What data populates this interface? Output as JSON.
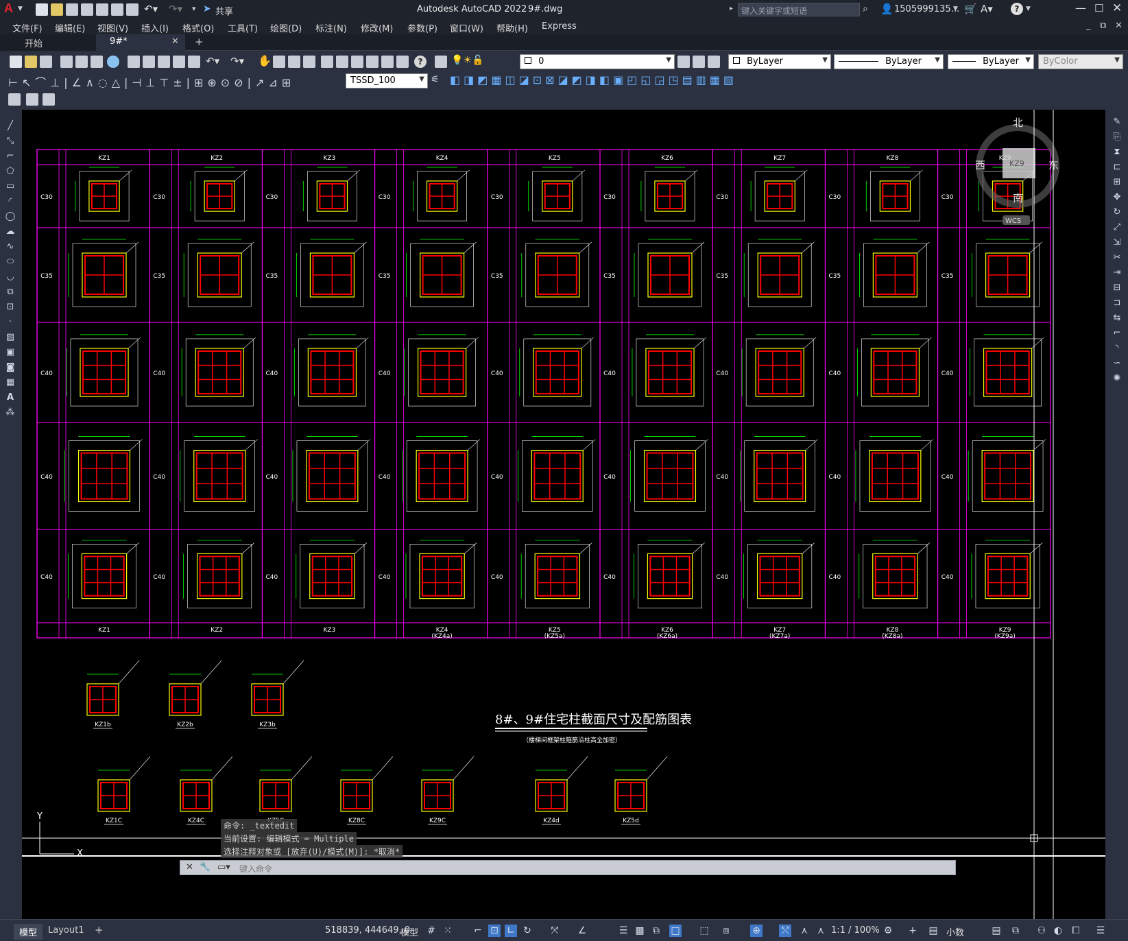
{
  "titlebar": {
    "app_logo": "A",
    "share_label": "共享",
    "title": "Autodesk AutoCAD 2022",
    "filename": "9#.dwg",
    "search_placeholder": "键入关键字或短语",
    "username": "1505999135...",
    "cart_icon": "cart-icon",
    "help_icon": "help-icon"
  },
  "menu": [
    "文件(F)",
    "编辑(E)",
    "视图(V)",
    "插入(I)",
    "格式(O)",
    "工具(T)",
    "绘图(D)",
    "标注(N)",
    "修改(M)",
    "参数(P)",
    "窗口(W)",
    "帮助(H)",
    "Express"
  ],
  "tabs": [
    {
      "label": "开始"
    },
    {
      "label": "9#*"
    },
    {
      "label": "+"
    }
  ],
  "toolbar": {
    "layer_value": "0",
    "color_value": "ByLayer",
    "linetype_value": "ByLayer",
    "lineweight_value": "ByLayer",
    "plotstyle_value": "ByColor",
    "dimstyle_value": "TSSD_100"
  },
  "viewcube": {
    "north": "北",
    "south": "南",
    "east": "东",
    "west": "西",
    "wcs": "WCS",
    "face": "KZ9"
  },
  "drawing": {
    "column_headers": [
      "KZ1",
      "KZ2",
      "KZ3",
      "KZ4",
      "KZ5",
      "KZ6",
      "KZ7",
      "KZ8",
      "KZ9"
    ],
    "footer_labels": [
      "KZ1",
      "KZ2",
      "KZ3",
      "KZ4\n(KZ4a)",
      "KZ5\n(KZ5a)",
      "KZ6\n(KZ6a)",
      "KZ7\n(KZ7a)",
      "KZ8\n(KZ8a)",
      "KZ9\n(KZ9a)"
    ],
    "row_grades": [
      "C30",
      "C35",
      "C40",
      "C40",
      "C40"
    ],
    "title": "8#、9#住宅柱截面尺寸及配筋图表",
    "subtitle": "（楼梯间框架柱箍筋沿柱高全加密）",
    "lower_row1": [
      "KZ1b",
      "KZ2b",
      "KZ3b"
    ],
    "lower_row2": [
      "KZ1C",
      "KZ4C",
      "KZ5C",
      "KZ8C",
      "KZ9C",
      "KZ4d",
      "KZ5d"
    ]
  },
  "command": {
    "line1": "命令:  _textedit",
    "line2": "当前设置: 编辑模式 = Multiple",
    "line3": "选择注释对象或 [放弃(U)/模式(M)]: *取消*",
    "input_placeholder": "键入命令"
  },
  "status": {
    "model_tab": "模型",
    "layout_tab": "Layout1",
    "add_tab": "+",
    "coords": "518839, 444649, 0",
    "model_label": "模型",
    "scale": "1:1 / 100%",
    "units": "小数"
  },
  "colors": {
    "grid_magenta": "#ff00ff",
    "rebar_red": "#ff0000",
    "outline_yellow": "#ffff00",
    "dim_green": "#00ff00",
    "text_white": "#ffffff"
  }
}
